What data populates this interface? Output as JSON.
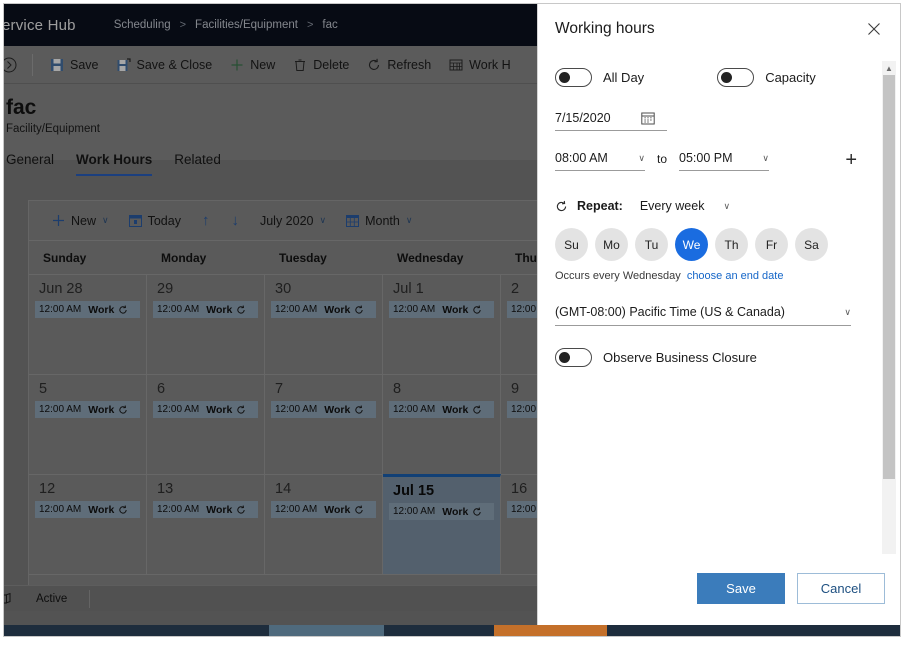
{
  "app": {
    "brand": "ervice Hub",
    "breadcrumb": [
      "Scheduling",
      "Facilities/Equipment",
      "fac"
    ],
    "breadcrumb_separator": ">",
    "commands": [
      {
        "label": "Save",
        "icon": "save-icon"
      },
      {
        "label": "Save & Close",
        "icon": "save-and-close-icon"
      },
      {
        "label": "New",
        "icon": "plus-icon"
      },
      {
        "label": "Delete",
        "icon": "trash-icon"
      },
      {
        "label": "Refresh",
        "icon": "refresh-icon"
      },
      {
        "label": "Work H",
        "icon": "work-hours-icon"
      }
    ],
    "record": {
      "title": "fac",
      "subtitle": "Facility/Equipment"
    },
    "tabs": [
      {
        "label": "General",
        "active": false
      },
      {
        "label": "Work Hours",
        "active": true
      },
      {
        "label": "Related",
        "active": false
      }
    ],
    "status": {
      "text": "Active",
      "icon": "popout-icon"
    }
  },
  "calendar": {
    "toolbar": {
      "new_label": "New",
      "today_label": "Today",
      "up_arrow": "↑",
      "down_arrow": "↓",
      "period_label": "July 2020",
      "view_label": "Month",
      "chevron": "∨"
    },
    "day_headers": [
      "Sunday",
      "Monday",
      "Tuesday",
      "Wednesday",
      "Thursday"
    ],
    "event_time": "12:00 AM",
    "event_title": "Work",
    "event_icon": "recurrence-icon",
    "weeks": [
      [
        {
          "day": "Jun 28",
          "selected": false,
          "has_event": true
        },
        {
          "day": "29",
          "selected": false,
          "has_event": true
        },
        {
          "day": "30",
          "selected": false,
          "has_event": true
        },
        {
          "day": "Jul 1",
          "selected": false,
          "has_event": true
        },
        {
          "day": "2",
          "selected": false,
          "has_event": true
        }
      ],
      [
        {
          "day": "5",
          "selected": false,
          "has_event": true
        },
        {
          "day": "6",
          "selected": false,
          "has_event": true
        },
        {
          "day": "7",
          "selected": false,
          "has_event": true
        },
        {
          "day": "8",
          "selected": false,
          "has_event": true
        },
        {
          "day": "9",
          "selected": false,
          "has_event": true
        }
      ],
      [
        {
          "day": "12",
          "selected": false,
          "has_event": true
        },
        {
          "day": "13",
          "selected": false,
          "has_event": true
        },
        {
          "day": "14",
          "selected": false,
          "has_event": true
        },
        {
          "day": "Jul 15",
          "selected": true,
          "has_event": true
        },
        {
          "day": "16",
          "selected": false,
          "has_event": true
        }
      ]
    ]
  },
  "panel": {
    "title": "Working hours",
    "close_icon": "close-icon",
    "toggles": [
      {
        "label": "All Day",
        "on": false
      },
      {
        "label": "Capacity",
        "on": false
      }
    ],
    "date": {
      "value": "7/15/2020",
      "icon": "calendar-icon"
    },
    "time": {
      "start": "08:00 AM",
      "separator": "to",
      "end": "05:00 PM",
      "add_icon": "plus-icon"
    },
    "repeat": {
      "icon": "repeat-icon",
      "label": "Repeat:",
      "value": "Every week",
      "days": [
        {
          "label": "Su",
          "selected": false
        },
        {
          "label": "Mo",
          "selected": false
        },
        {
          "label": "Tu",
          "selected": false
        },
        {
          "label": "We",
          "selected": true
        },
        {
          "label": "Th",
          "selected": false
        },
        {
          "label": "Fr",
          "selected": false
        },
        {
          "label": "Sa",
          "selected": false
        }
      ],
      "occurs_text": "Occurs every Wednesday",
      "end_date_link": "choose an end date"
    },
    "timezone": {
      "value": "(GMT-08:00) Pacific Time (US & Canada)"
    },
    "business_closure": {
      "label": "Observe Business Closure",
      "on": false
    },
    "footer": {
      "save_label": "Save",
      "cancel_label": "Cancel"
    }
  },
  "colors": {
    "accent_blue": "#1a6ce0",
    "primary_button": "#3b7cbb",
    "header_dark": "#0b1220",
    "link": "#1566c8"
  }
}
